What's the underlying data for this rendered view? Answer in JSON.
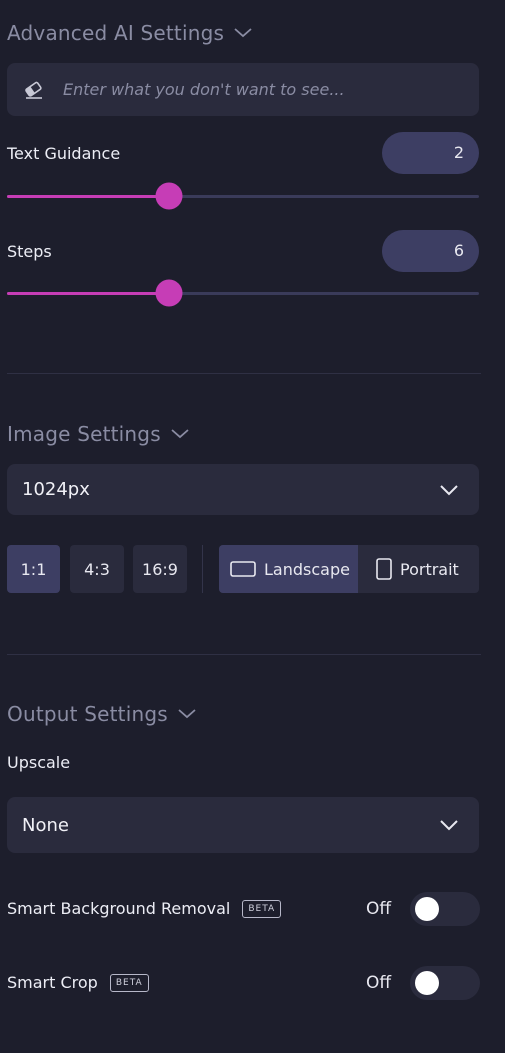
{
  "advanced_ai": {
    "title": "Advanced AI Settings",
    "negative_prompt": {
      "placeholder": "Enter what you don't want to see...",
      "value": ""
    },
    "text_guidance": {
      "label": "Text Guidance",
      "value": "2",
      "fraction": 0.34
    },
    "steps": {
      "label": "Steps",
      "value": "6",
      "fraction": 0.34
    }
  },
  "image_settings": {
    "title": "Image Settings",
    "size": "1024px",
    "ratios": [
      "1:1",
      "4:3",
      "16:9"
    ],
    "selected_ratio": "1:1",
    "orientations": [
      "Landscape",
      "Portrait"
    ],
    "selected_orientation": "Landscape"
  },
  "output_settings": {
    "title": "Output Settings",
    "upscale_label": "Upscale",
    "upscale_value": "None",
    "smart_background_removal": {
      "label": "Smart Background Removal",
      "badge": "BETA",
      "state": "Off"
    },
    "smart_crop": {
      "label": "Smart Crop",
      "badge": "BETA",
      "state": "Off"
    }
  },
  "colors": {
    "background": "#1d1e2c",
    "accent": "#c63db6",
    "panel": "#2a2b3d",
    "active": "#3d3e63"
  }
}
